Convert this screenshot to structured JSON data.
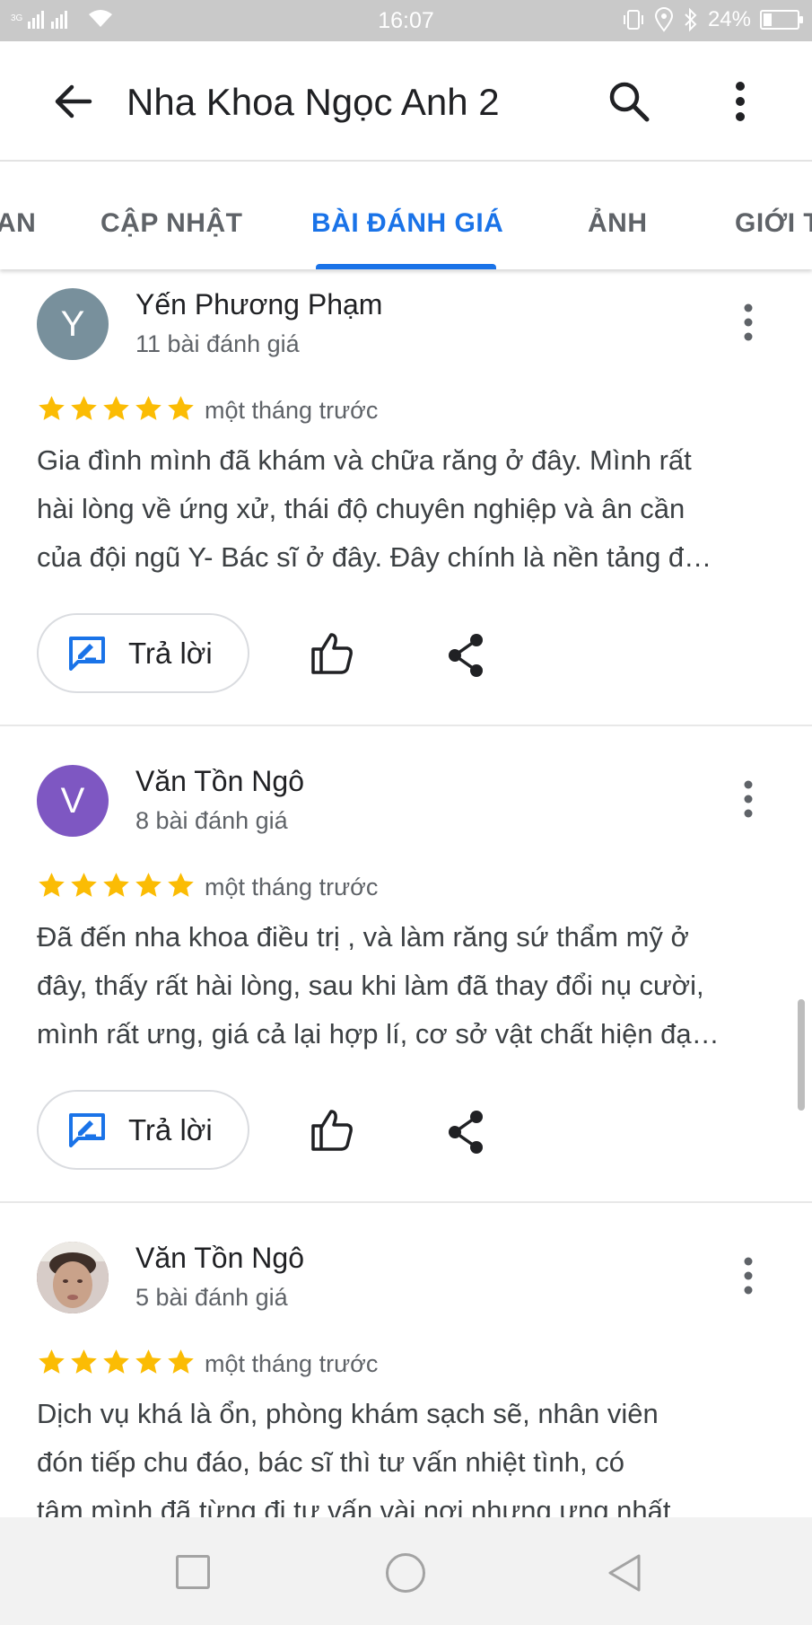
{
  "status_bar": {
    "time": "16:07",
    "network": "3G",
    "battery": "24%",
    "battery_level": 0.24
  },
  "app_bar": {
    "title": "Nha Khoa Ngọc Anh 2"
  },
  "tabs": [
    {
      "label": "TỔNG QUAN",
      "visible_text": "AN",
      "active": false
    },
    {
      "label": "CẬP NHẬT",
      "active": false
    },
    {
      "label": "BÀI ĐÁNH GIÁ",
      "active": true
    },
    {
      "label": "ẢNH",
      "active": false
    },
    {
      "label": "GIỚI THIỆU",
      "visible_text": "GIỚI T",
      "active": false
    }
  ],
  "reviews": [
    {
      "author": "Yến Phương Phạm",
      "initial": "Y",
      "avatar_color": "#78909c",
      "review_count": "11 bài đánh giá",
      "rating": 5,
      "time": "một tháng trước",
      "text_lines": [
        "Gia đình mình đã khám và chữa răng ở đây. Mình rất",
        "hài lòng về ứng xử, thái độ chuyên nghiệp và ân cần",
        "của đội ngũ Y- Bác sĩ ở đây. Đây chính là nền tảng đ…"
      ],
      "reply_label": "Trả lời"
    },
    {
      "author": "Văn Tồn Ngô",
      "initial": "V",
      "avatar_color": "#7e57c2",
      "review_count": "8 bài đánh giá",
      "rating": 5,
      "time": "một tháng trước",
      "text_lines": [
        "Đã đến nha khoa điều trị , và làm răng sứ thẩm mỹ ở",
        "đây, thấy rất hài lòng, sau khi làm đã thay đổi nụ cười,",
        "mình rất ưng, giá cả lại hợp lí, cơ sở vật chất hiện đạ…"
      ],
      "reply_label": "Trả lời"
    },
    {
      "author": "Văn Tồn Ngô",
      "initial": "",
      "avatar_color": "#8d6e63",
      "review_count": "5 bài đánh giá",
      "rating": 5,
      "time": "một tháng trước",
      "text_lines": [
        "Dịch vụ khá là ổn, phòng khám sạch sẽ, nhân viên",
        "đón tiếp chu đáo, bác sĩ thì tư vấn nhiệt tình, có",
        "tâm mình đã từng đi tư vấn vài nơi nhưng ưng nhất"
      ],
      "reply_label": "Trả lời"
    }
  ],
  "colors": {
    "accent": "#1a73e8",
    "star": "#fbbc04"
  }
}
